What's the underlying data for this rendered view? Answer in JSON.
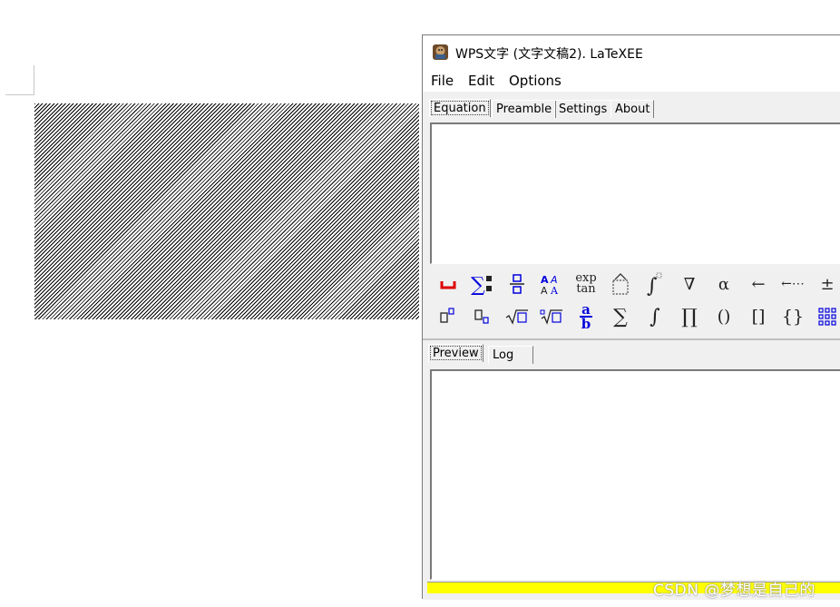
{
  "window": {
    "title": "WPS文字 (文字文稿2). LaTeXEE"
  },
  "menu": {
    "file": "File",
    "edit": "Edit",
    "options": "Options"
  },
  "tabs": {
    "equation": "Equation",
    "preamble": "Preamble",
    "settings": "Settings",
    "about": "About"
  },
  "toolbar": {
    "exp_tan_top": "exp",
    "exp_tan_bottom": "tan",
    "fraction_top": "a",
    "fraction_bottom": "b",
    "sum": "∑",
    "integral": "∫",
    "product": "∏",
    "parens": "()",
    "brackets": "[]",
    "braces": "{}",
    "nabla": "∇",
    "alpha": "α",
    "left_arrow": "←",
    "dotted_arrow": "←⋯",
    "plus_minus": "±"
  },
  "bottom_tabs": {
    "preview": "Preview",
    "log": "Log"
  },
  "watermark": "CSDN @梦想是自己的",
  "colors": {
    "status_bar": "#ffff00",
    "accent_blue": "#0000dd",
    "accent_red": "#dd0000"
  }
}
